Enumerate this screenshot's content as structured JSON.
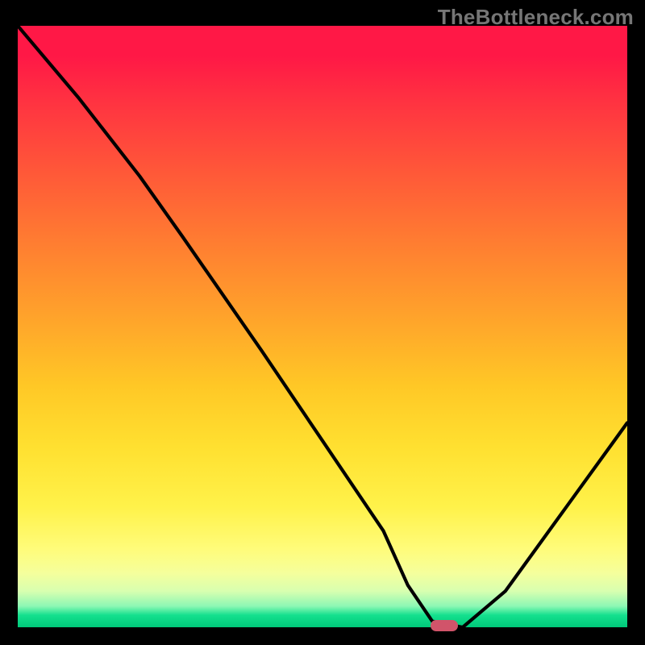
{
  "watermark": "TheBottleneck.com",
  "chart_data": {
    "type": "line",
    "title": "",
    "xlabel": "",
    "ylabel": "",
    "xlim": [
      0,
      100
    ],
    "ylim": [
      0,
      100
    ],
    "grid": false,
    "x": [
      0,
      10,
      20,
      27,
      40,
      50,
      60,
      64,
      68,
      73,
      80,
      90,
      100
    ],
    "values": [
      100,
      88,
      75,
      65,
      46,
      31,
      16,
      7,
      1,
      0,
      6,
      20,
      34
    ],
    "minimum_marker": {
      "x": 70,
      "y": 0
    },
    "background": "vertical spectral gradient red→yellow→green",
    "annotations": [],
    "legend": []
  },
  "colors": {
    "frame": "#000000",
    "curve": "#000000",
    "marker": "#d1546a",
    "watermark": "#767676"
  }
}
